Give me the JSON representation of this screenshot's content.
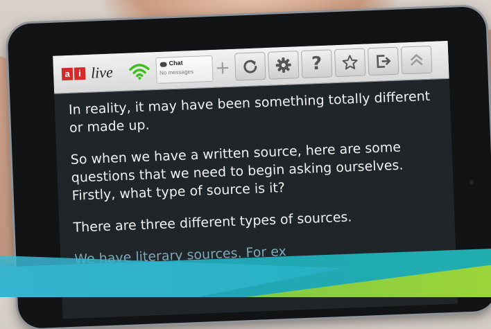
{
  "app": {
    "logo_letters": [
      "a",
      "i"
    ],
    "logo_word": "live",
    "wifi_icon": "wifi-icon",
    "brand_red": "#d42a2a",
    "wifi_green": "#3fbf1c"
  },
  "chat": {
    "title": "Chat",
    "status": "No messages"
  },
  "toolbar": {
    "add_icon": "plus-icon",
    "refresh_icon": "refresh-icon",
    "settings_icon": "gear-icon",
    "help_label": "?",
    "favorite_icon": "star-icon",
    "exit_icon": "exit-icon",
    "collapse_icon": "chevron-up-icon"
  },
  "content": {
    "paragraphs": [
      "In reality, it may have been something totally different or made up.",
      "So when we have a written source, here are some questions that we need to begin asking ourselves. Firstly, what type of source is it?",
      "There are three different types of sources.",
      "We have literary sources. For ex"
    ]
  }
}
